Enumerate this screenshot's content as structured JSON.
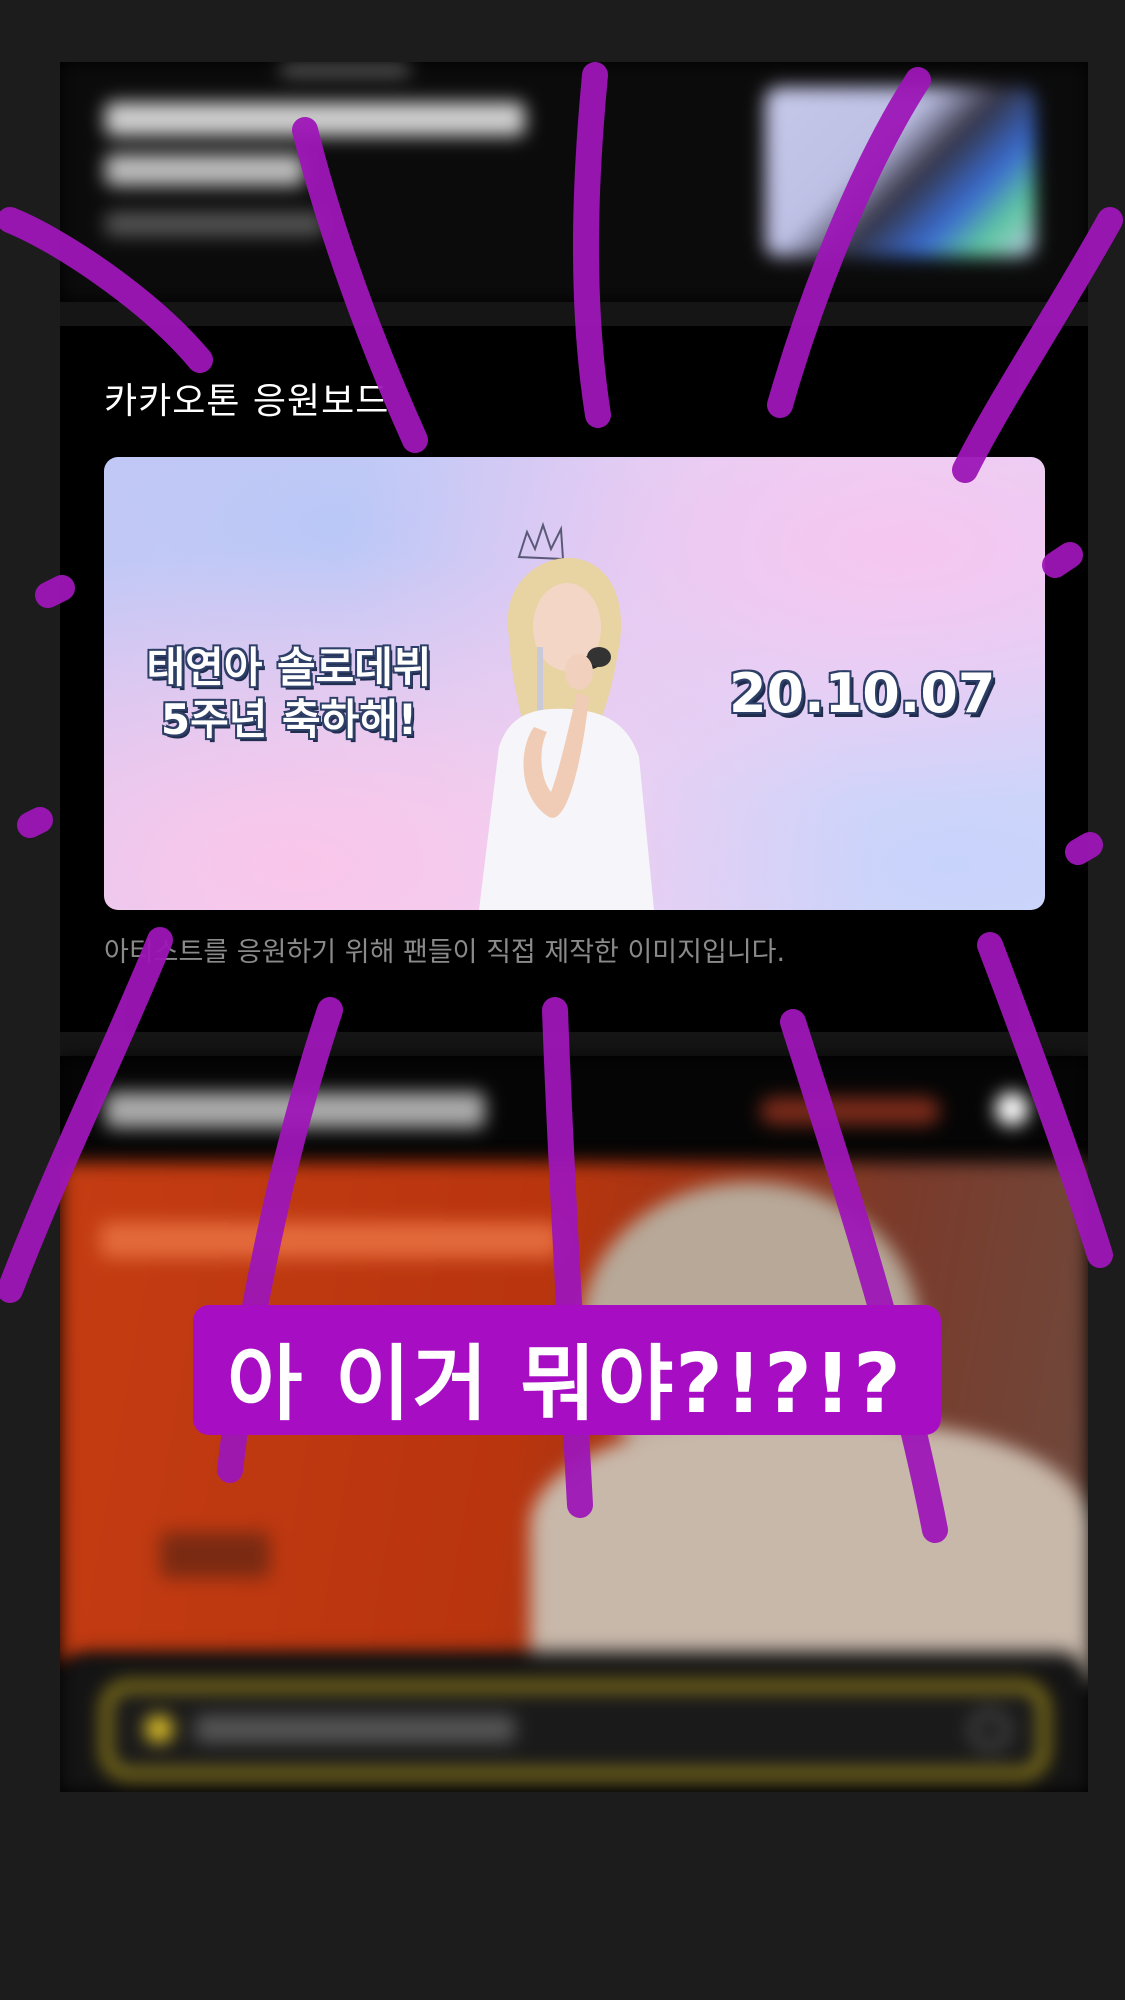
{
  "section": {
    "title": "카카오톤 응원보드",
    "caption": "아티스트를 응원하기 위해 팬들이 직접 제작한 이미지입니다."
  },
  "banner": {
    "line1": "태연아 솔로데뷔",
    "line2": "5주년 축하해!",
    "date": "20.10.07"
  },
  "sticker": {
    "text": "아 이거 뭐야?!?!?"
  },
  "colors": {
    "scribble": "#9d16b7",
    "sticker_bg": "#a70ec4",
    "search_border": "#bfa51c"
  }
}
